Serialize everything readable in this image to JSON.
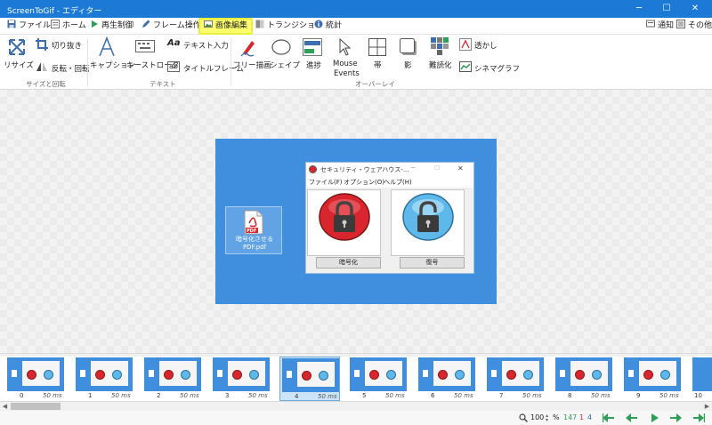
{
  "window": {
    "title": "ScreenToGif - エディター",
    "min_glyph": "─",
    "max_glyph": "☐",
    "close_glyph": "✕"
  },
  "menu": {
    "tabs": [
      {
        "label": "ファイル",
        "icon": "save-icon"
      },
      {
        "label": "ホーム",
        "icon": "home-icon"
      },
      {
        "label": "再生制御",
        "icon": "play-icon"
      },
      {
        "label": "フレーム操作",
        "icon": "pencil-icon"
      },
      {
        "label": "画像編集",
        "icon": "image-icon",
        "active": true
      },
      {
        "label": "トランジション",
        "icon": "transition-icon"
      },
      {
        "label": "統計",
        "icon": "info-icon"
      }
    ],
    "notify_label": "通知",
    "other_label": "その他"
  },
  "ribbon": {
    "resize": "リサイズ",
    "crop": "切り抜き",
    "flip": "反転・回転",
    "group_size": "サイズと回転",
    "caption": "キャプション",
    "keystrokes": "キーストローク",
    "free_text": "テキスト入力",
    "title_frame": "タイトルフレーム",
    "group_text": "テキスト",
    "free_draw": "フリー描画",
    "shape": "シェイプ",
    "progress": "進捗",
    "mouse_events_1": "Mouse",
    "mouse_events_2": "Events",
    "border": "帯",
    "shadow": "影",
    "obfuscate": "難読化",
    "watermark": "透かし",
    "cinemagraph": "シネマグラフ",
    "group_overlay": "オーバーレイ"
  },
  "recording": {
    "desktop_icon_line1": "暗号化させる",
    "desktop_icon_line2": "PDF.pdf",
    "dialog_title": "セキュリティ・ウェアハウス-...",
    "dialog_menu": [
      "ファイル(F)",
      "オプション(O)",
      "ヘルプ(H)"
    ],
    "encrypt_button": "暗号化",
    "decrypt_button": "復号",
    "pdf_label": "PDF"
  },
  "frames": [
    {
      "index": "0",
      "delay": "50 ms"
    },
    {
      "index": "1",
      "delay": "50 ms"
    },
    {
      "index": "2",
      "delay": "50 ms"
    },
    {
      "index": "3",
      "delay": "50 ms"
    },
    {
      "index": "4",
      "delay": "50 ms",
      "selected": true
    },
    {
      "index": "5",
      "delay": "50 ms"
    },
    {
      "index": "6",
      "delay": "50 ms"
    },
    {
      "index": "7",
      "delay": "50 ms"
    },
    {
      "index": "8",
      "delay": "50 ms"
    },
    {
      "index": "9",
      "delay": "50 ms"
    },
    {
      "index": "10",
      "delay": ""
    }
  ],
  "status": {
    "zoom": "100",
    "zoom_unit": "%",
    "frame_count": "147",
    "selected_count": "1",
    "current_frame": "4"
  },
  "colors": {
    "title_bar": "#1c7ad6",
    "active_tab": "#fffe6c",
    "desktop": "#3f8fde",
    "encrypt": "#d9262e",
    "decrypt": "#5fb8ea",
    "nav_green": "#2f9e57"
  }
}
